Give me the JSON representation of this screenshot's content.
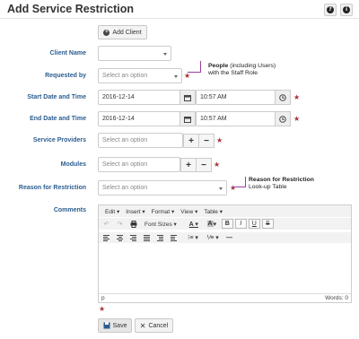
{
  "header": {
    "title": "Add Service Restriction",
    "help_icon": "question-circle-icon",
    "info_icon": "info-circle-icon"
  },
  "add_client_label": "Add Client",
  "form": {
    "client_name_label": "Client Name",
    "requested_by_label": "Requested by",
    "requested_by_placeholder": "Select an option",
    "start_label": "Start Date and Time",
    "start_date": "2016-12-14",
    "start_time": "10:57 AM",
    "end_label": "End Date and Time",
    "end_date": "2016-12-14",
    "end_time": "10:57 AM",
    "providers_label": "Service Providers",
    "providers_placeholder": "Select an option",
    "modules_label": "Modules",
    "modules_placeholder": "Select an option",
    "reason_label": "Reason for Restriction",
    "reason_placeholder": "Select an option",
    "comments_label": "Comments",
    "required_mark": "★"
  },
  "annotations": {
    "people_bold": "People",
    "people_rest": "(including Users)",
    "people_line2": "with the Staff Role",
    "reason_bold": "Reason for Restriction",
    "reason_line2": "Look-up Table"
  },
  "editor": {
    "menus": [
      "Edit",
      "Insert",
      "Format",
      "View",
      "Table"
    ],
    "font_sizes_label": "Font Sizes",
    "status_path": "p",
    "word_count": "Words: 0"
  },
  "actions": {
    "save_label": "Save",
    "cancel_label": "Cancel"
  },
  "colors": {
    "label_blue": "#2a5d8f",
    "required_red": "#a33333",
    "annotation_purple": "#9b3fa0"
  }
}
